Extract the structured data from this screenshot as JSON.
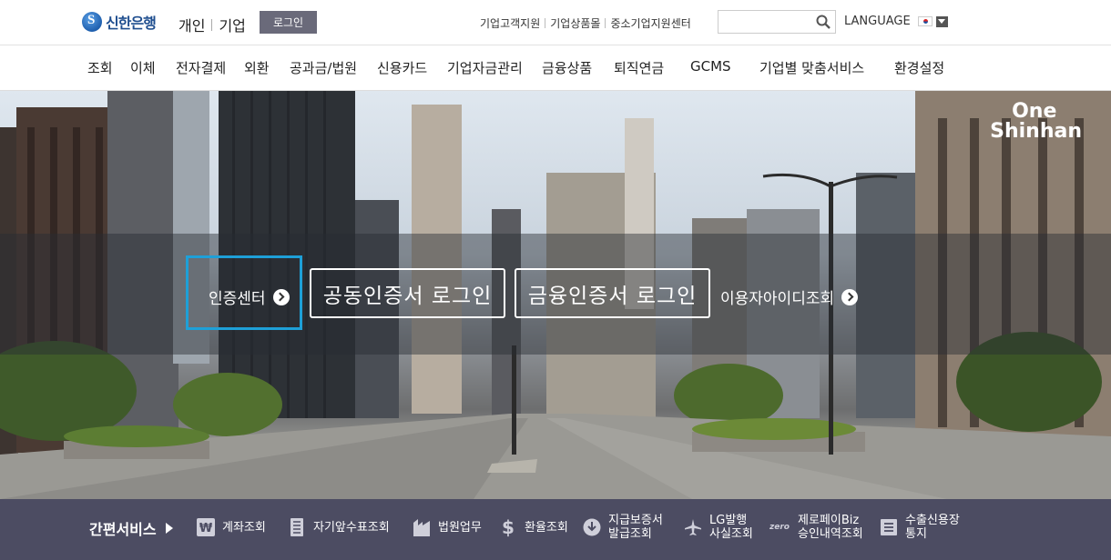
{
  "header": {
    "logo_text": "신한은행",
    "segment_personal": "개인",
    "segment_corporate": "기업",
    "login_label": "로그인",
    "util_links": [
      "기업고객지원",
      "기업상품몰",
      "중소기업지원센터"
    ],
    "search_placeholder": "",
    "language_label": "LANGUAGE"
  },
  "gnb": [
    "조회",
    "이체",
    "전자결제",
    "외환",
    "공과금/법원",
    "신용카드",
    "기업자금관리",
    "금융상품",
    "퇴직연금",
    "GCMS",
    "기업별 맞춤서비스",
    "환경설정"
  ],
  "hero": {
    "brand_line1": "One",
    "brand_line2": "Shinhan",
    "cert_center": "인증센터",
    "joint_cert_login": "공동인증서 로그인",
    "finance_cert_login": "금융인증서 로그인",
    "user_id_lookup": "이용자아이디조회"
  },
  "quick": {
    "title": "간편서비스",
    "items": [
      {
        "label": "계좌조회",
        "icon": "won-icon"
      },
      {
        "label": "자기앞수표조회",
        "icon": "check-icon"
      },
      {
        "label": "법원업무",
        "icon": "court-icon"
      },
      {
        "label": "환율조회",
        "icon": "dollar-icon"
      },
      {
        "label": "지급보증서\n발급조회",
        "icon": "download-icon"
      },
      {
        "label": "LG발행\n사실조회",
        "icon": "plane-icon"
      },
      {
        "label": "제로페이Biz\n승인내역조회",
        "icon": "zero-icon"
      },
      {
        "label": "수출신용장\n통지",
        "icon": "document-icon"
      }
    ],
    "zero_mark": "zero"
  },
  "colors": {
    "brand_blue": "#1f4e8f",
    "cert_highlight": "#1ea0d8",
    "quick_bg": "#4c4c62",
    "login_btn": "#6a6a7a"
  }
}
